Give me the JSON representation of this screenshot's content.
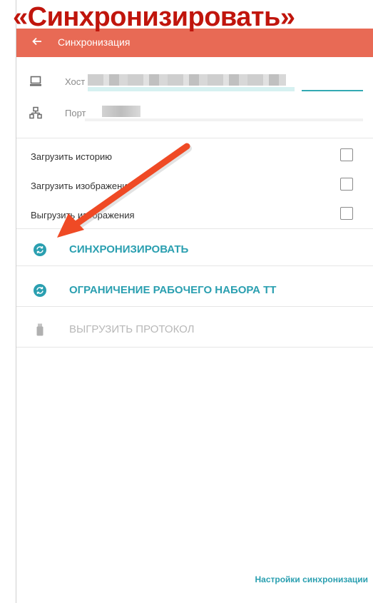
{
  "overlay": {
    "title": "«Синхронизировать»"
  },
  "appbar": {
    "title": "Синхронизация",
    "back_icon": "arrow-left-icon",
    "color": "#e86a55"
  },
  "fields": {
    "host": {
      "label": "Хост",
      "icon": "laptop-icon"
    },
    "port": {
      "label": "Порт",
      "icon": "network-icon"
    }
  },
  "checkboxes": [
    {
      "label": "Загрузить историю",
      "checked": false
    },
    {
      "label": "Загрузить изображения",
      "checked": false
    },
    {
      "label": "Выгрузить изображения",
      "checked": false
    }
  ],
  "actions": [
    {
      "label": "СИНХРОНИЗИРОВАТЬ",
      "icon": "sync-icon",
      "enabled": true
    },
    {
      "label": "ОГРАНИЧЕНИЕ РАБОЧЕГО НАБОРА ТТ",
      "icon": "sync-icon",
      "enabled": true
    },
    {
      "label": "ВЫГРУЗИТЬ ПРОТОКОЛ",
      "icon": "usb-drive-icon",
      "enabled": false
    }
  ],
  "footer": {
    "link": "Настройки синхронизации"
  },
  "colors": {
    "accent": "#2a9fb0",
    "arrow": "#ef4a25",
    "overlay_title": "#c0150c"
  }
}
